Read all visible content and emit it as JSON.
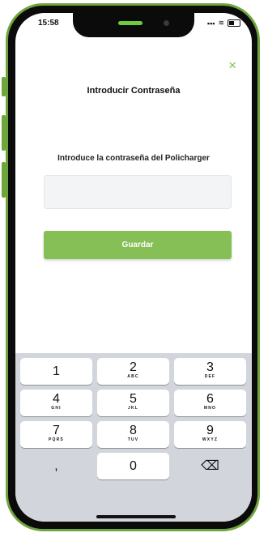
{
  "status_bar": {
    "time": "15:58",
    "signal": "▪▪▪",
    "wifi": "≋"
  },
  "dialog": {
    "close_glyph": "×",
    "title": "Introducir Contraseña",
    "prompt": "Introduce la contraseña del Policharger",
    "password_value": "",
    "save_label": "Guardar"
  },
  "keyboard": {
    "keys": [
      {
        "num": "1",
        "sub": ""
      },
      {
        "num": "2",
        "sub": "ABC"
      },
      {
        "num": "3",
        "sub": "DEF"
      },
      {
        "num": "4",
        "sub": "GHI"
      },
      {
        "num": "5",
        "sub": "JKL"
      },
      {
        "num": "6",
        "sub": "MNO"
      },
      {
        "num": "7",
        "sub": "PQRS"
      },
      {
        "num": "8",
        "sub": "TUV"
      },
      {
        "num": "9",
        "sub": "WXYZ"
      },
      {
        "num": ",",
        "sub": ""
      },
      {
        "num": "0",
        "sub": ""
      },
      {
        "num": "⌫",
        "sub": ""
      }
    ]
  },
  "colors": {
    "accent": "#86bf56",
    "frame": "#6ea53c",
    "keyboard_bg": "#d2d5db"
  }
}
